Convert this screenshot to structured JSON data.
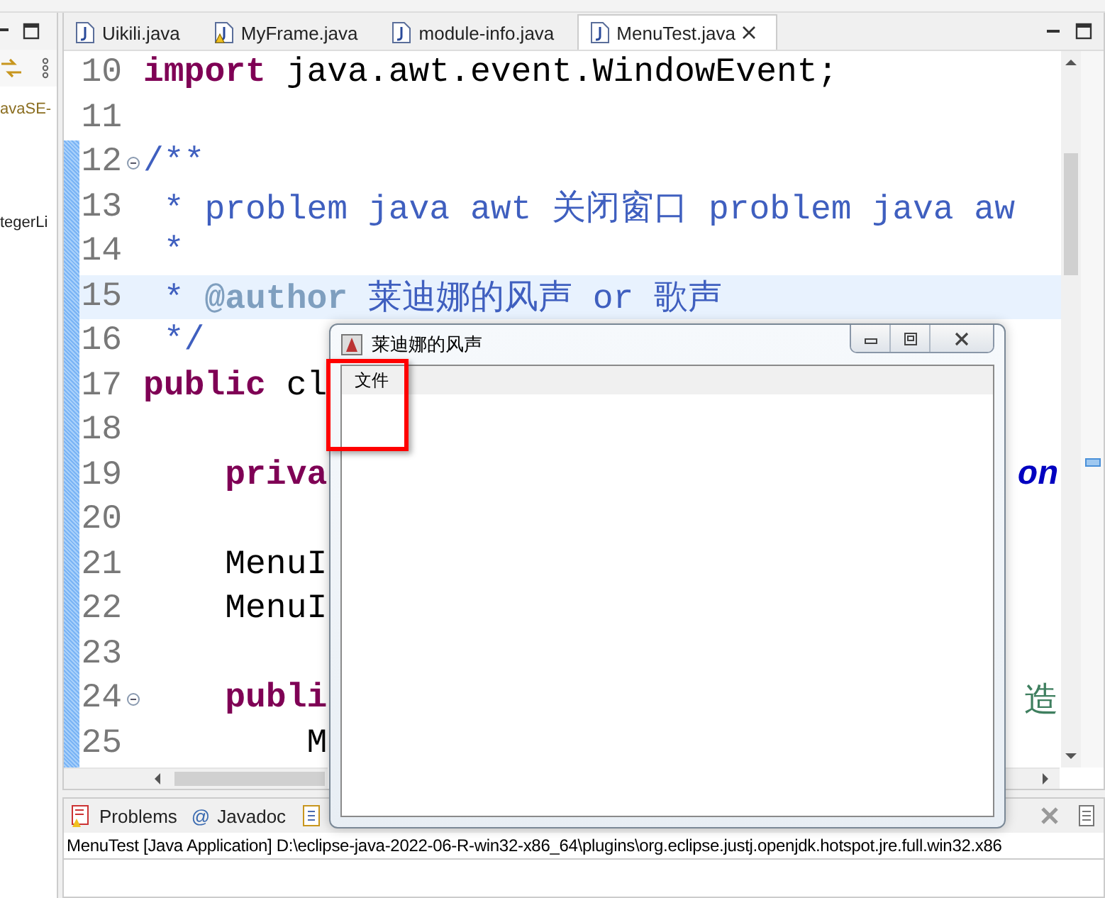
{
  "explorer": {
    "items": [
      {
        "label": "avaSE-"
      },
      {
        "label": "tegerLi"
      }
    ]
  },
  "editor_tabs": [
    {
      "label": "Uikili.java",
      "selected": false,
      "warning": false
    },
    {
      "label": "MyFrame.java",
      "selected": false,
      "warning": true
    },
    {
      "label": "module-info.java",
      "selected": false,
      "warning": false
    },
    {
      "label": "MenuTest.java",
      "selected": true,
      "warning": false
    }
  ],
  "code_lines": [
    {
      "number": "10",
      "fold": false,
      "highlighted": false,
      "left": [
        {
          "text": "import",
          "kind": "keyword"
        },
        {
          "text": " java.awt.event.WindowEvent;",
          "kind": "plain"
        }
      ]
    },
    {
      "number": "11",
      "fold": false,
      "highlighted": false
    },
    {
      "number": "12",
      "fold": true,
      "highlighted": false,
      "left": [
        {
          "text": "/**",
          "kind": "doc"
        }
      ]
    },
    {
      "number": "13",
      "fold": false,
      "highlighted": false,
      "left": [
        {
          "text": " * problem java awt 关闭窗口 problem java aw",
          "kind": "doc"
        }
      ]
    },
    {
      "number": "14",
      "fold": false,
      "highlighted": false,
      "left": [
        {
          "text": " *",
          "kind": "doc"
        }
      ]
    },
    {
      "number": "15",
      "fold": false,
      "highlighted": true,
      "left": [
        {
          "text": " * ",
          "kind": "doc"
        },
        {
          "text": "@author",
          "kind": "tag"
        },
        {
          "text": " 莱迪娜的风声 or 歌声",
          "kind": "doc"
        }
      ]
    },
    {
      "number": "16",
      "fold": false,
      "highlighted": false,
      "left": [
        {
          "text": " */",
          "kind": "doc"
        }
      ]
    },
    {
      "number": "17",
      "fold": false,
      "highlighted": false,
      "left": [
        {
          "text": "public",
          "kind": "keyword"
        },
        {
          "text": " cl",
          "kind": "plain"
        }
      ]
    },
    {
      "number": "18",
      "fold": false,
      "highlighted": false
    },
    {
      "number": "19",
      "fold": false,
      "highlighted": false,
      "left": [
        {
          "text": "    priva",
          "kind": "keyword"
        }
      ],
      "right": {
        "text": "on",
        "kind": "field"
      }
    },
    {
      "number": "20",
      "fold": false,
      "highlighted": false
    },
    {
      "number": "21",
      "fold": false,
      "highlighted": false,
      "left": [
        {
          "text": "    MenuI",
          "kind": "plain"
        }
      ]
    },
    {
      "number": "22",
      "fold": false,
      "highlighted": false,
      "left": [
        {
          "text": "    MenuI",
          "kind": "plain"
        }
      ]
    },
    {
      "number": "23",
      "fold": false,
      "highlighted": false
    },
    {
      "number": "24",
      "fold": true,
      "highlighted": false,
      "left": [
        {
          "text": "    publi",
          "kind": "keyword"
        }
      ],
      "right": {
        "text": "造",
        "kind": "comment"
      }
    },
    {
      "number": "25",
      "fold": false,
      "highlighted": false,
      "left": [
        {
          "text": "        M",
          "kind": "plain"
        }
      ]
    }
  ],
  "bottom_tabs": [
    {
      "label": "Problems",
      "kind": "problems"
    },
    {
      "label": "Javadoc",
      "kind": "javadoc",
      "glyph": "@"
    }
  ],
  "console": {
    "label": "MenuTest [Java Application] D:\\eclipse-java-2022-06-R-win32-x86_64\\plugins\\org.eclipse.justj.openjdk.hotspot.jre.full.win32.x86"
  },
  "frame_window": {
    "title": "莱迪娜的风声",
    "menus": [
      "文件"
    ]
  }
}
